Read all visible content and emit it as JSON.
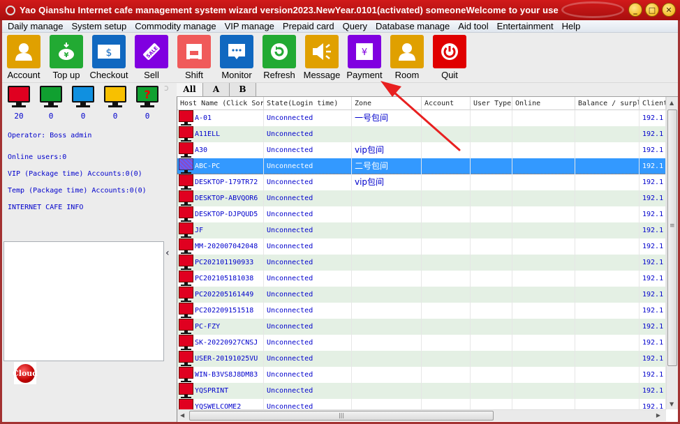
{
  "window": {
    "title": "Yao Qianshu Internet cafe management system wizard version2023.NewYear.0101(activated)  someoneWelcome to your use",
    "controls": {
      "minimize": "_",
      "maximize": "□",
      "close": "✕"
    }
  },
  "menu": [
    "Daily manage",
    "System setup",
    "Commodity manage",
    "VIP manage",
    "Prepaid card",
    "Query",
    "Database manage",
    "Aid tool",
    "Entertainment",
    "Help"
  ],
  "toolbar": [
    {
      "label": "Account",
      "icon": "user-icon",
      "color": "#e0a000"
    },
    {
      "label": "Top up",
      "icon": "piggy-bank-icon",
      "color": "#22aa33"
    },
    {
      "label": "Checkout",
      "icon": "dollar-bill-icon",
      "color": "#1068c0"
    },
    {
      "label": "Sell",
      "icon": "sale-tag-icon",
      "color": "#8000e0"
    },
    {
      "label": "Shift",
      "icon": "handover-icon",
      "color": "#f05a5a"
    },
    {
      "label": "Monitor",
      "icon": "chat-bubble-icon",
      "color": "#1068c0"
    },
    {
      "label": "Refresh",
      "icon": "refresh-icon",
      "color": "#22aa33"
    },
    {
      "label": "Message",
      "icon": "speaker-icon",
      "color": "#e0a000"
    },
    {
      "label": "Payment",
      "icon": "yen-icon",
      "color": "#8000e0"
    },
    {
      "label": "Room",
      "icon": "user-icon",
      "color": "#e0a000"
    },
    {
      "label": "Quit",
      "icon": "power-icon",
      "color": "#e00000"
    }
  ],
  "status_monitors": [
    {
      "state": "offline",
      "color": "#e00020",
      "count": "20"
    },
    {
      "state": "online",
      "color": "#10a030",
      "count": "0"
    },
    {
      "state": "locked",
      "color": "#1090e0",
      "count": "0"
    },
    {
      "state": "busy",
      "color": "#f8c000",
      "count": "0"
    },
    {
      "state": "unknown",
      "color": "#10a030",
      "count": "0",
      "glyph": "?"
    }
  ],
  "left_info": {
    "operator": "Operator: Boss admin",
    "online_users": "Online users:0",
    "vip_accounts": "VIP (Package time) Accounts:0(0)",
    "temp_accounts": "Temp (Package time) Accounts:0(0)",
    "cafe_info": "INTERNET CAFE  INFO",
    "cloud_badge": "Cloud"
  },
  "splitter": {
    "collapse_glyph": "‹"
  },
  "tabs": [
    "All",
    "A",
    "B"
  ],
  "grid": {
    "columns": [
      "Host Name (Click Sort)",
      "State(Login time)",
      "Zone",
      "Account",
      "User Type",
      "Online",
      "Balance / surplus",
      "Client IP"
    ],
    "rows": [
      {
        "host": "A-01",
        "state": "Unconnected",
        "zone": "一号包间",
        "ip": "192.1"
      },
      {
        "host": "A11ELL",
        "state": "Unconnected",
        "zone": "",
        "ip": "192.1"
      },
      {
        "host": "A30",
        "state": "Unconnected",
        "zone": "vip包间",
        "ip": "192.1"
      },
      {
        "host": "ABC-PC",
        "state": "Unconnected",
        "zone": "二号包间",
        "ip": "192.1",
        "selected": true
      },
      {
        "host": "DESKTOP-179TR72",
        "state": "Unconnected",
        "zone": "vip包间",
        "ip": "192.1"
      },
      {
        "host": "DESKTOP-ABVQOR6",
        "state": "Unconnected",
        "zone": "",
        "ip": "192.1"
      },
      {
        "host": "DESKTOP-DJPQUD5",
        "state": "Unconnected",
        "zone": "",
        "ip": "192.1"
      },
      {
        "host": "JF",
        "state": "Unconnected",
        "zone": "",
        "ip": "192.1"
      },
      {
        "host": "MM-202007042048",
        "state": "Unconnected",
        "zone": "",
        "ip": "192.1"
      },
      {
        "host": "PC202101190933",
        "state": "Unconnected",
        "zone": "",
        "ip": "192.1"
      },
      {
        "host": "PC202105181038",
        "state": "Unconnected",
        "zone": "",
        "ip": "192.1"
      },
      {
        "host": "PC202205161449",
        "state": "Unconnected",
        "zone": "",
        "ip": "192.1"
      },
      {
        "host": "PC202209151518",
        "state": "Unconnected",
        "zone": "",
        "ip": "192.1"
      },
      {
        "host": "PC-FZY",
        "state": "Unconnected",
        "zone": "",
        "ip": "192.1"
      },
      {
        "host": "SK-20220927CNSJ",
        "state": "Unconnected",
        "zone": "",
        "ip": "192.1"
      },
      {
        "host": "USER-20191025VU",
        "state": "Unconnected",
        "zone": "",
        "ip": "192.1"
      },
      {
        "host": "WIN-B3VS8J8DM83",
        "state": "Unconnected",
        "zone": "",
        "ip": "192.1"
      },
      {
        "host": "YQSPRINT",
        "state": "Unconnected",
        "zone": "",
        "ip": "192.1"
      },
      {
        "host": "YQSWELCOME2",
        "state": "Unconnected",
        "zone": "",
        "ip": "192.1"
      }
    ]
  },
  "annotation": {
    "type": "arrow",
    "color": "#e82020",
    "points_to": "Payment"
  }
}
